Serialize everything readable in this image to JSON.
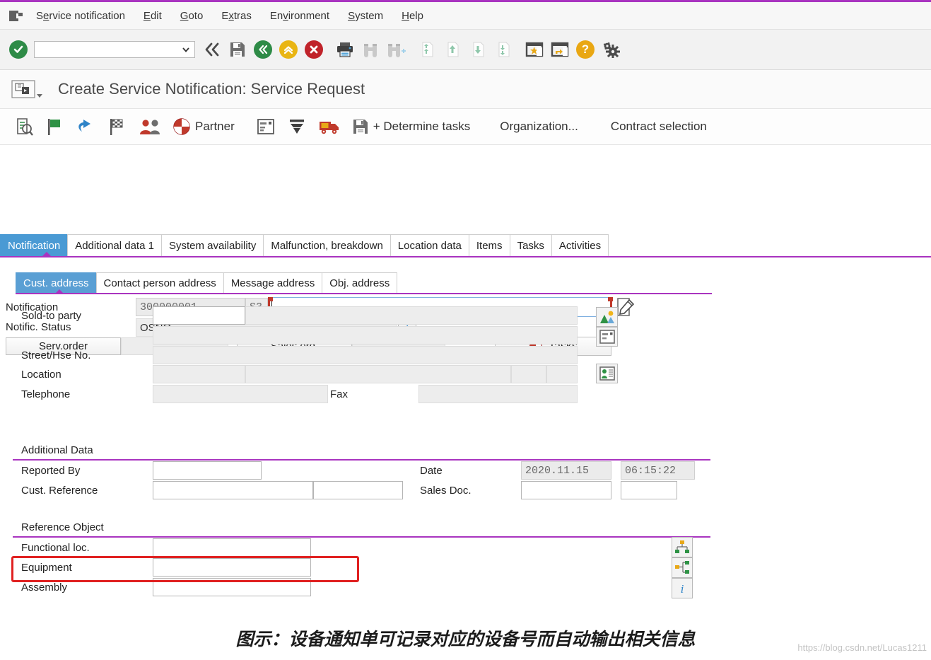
{
  "menubar": {
    "system_icon": "sap-exit-icon",
    "items": [
      {
        "pre": "S",
        "acc": "e",
        "post": "rvice notification"
      },
      {
        "pre": "",
        "acc": "E",
        "post": "dit"
      },
      {
        "pre": "",
        "acc": "G",
        "post": "oto"
      },
      {
        "pre": "E",
        "acc": "x",
        "post": "tras"
      },
      {
        "pre": "En",
        "acc": "v",
        "post": "ironment"
      },
      {
        "pre": "",
        "acc": "S",
        "post": "ystem"
      },
      {
        "pre": "",
        "acc": "H",
        "post": "elp"
      }
    ],
    "labels": [
      "Service notification",
      "Edit",
      "Goto",
      "Extras",
      "Environment",
      "System",
      "Help"
    ]
  },
  "std_toolbar": {
    "command_field_value": "",
    "command_field_placeholder": "",
    "buttons": [
      {
        "name": "enter-button",
        "icon": "green-check-icon",
        "enabled": true
      },
      {
        "name": "back-button",
        "icon": "back-double-arrow-icon",
        "enabled": true
      },
      {
        "name": "save-button",
        "icon": "save-floppy-icon",
        "enabled": true
      },
      {
        "name": "exit-button",
        "icon": "green-back-circle-icon",
        "enabled": true
      },
      {
        "name": "up-button",
        "icon": "yellow-up-circle-icon",
        "enabled": true
      },
      {
        "name": "cancel-button",
        "icon": "red-cancel-circle-icon",
        "enabled": true
      },
      {
        "name": "print-button",
        "icon": "printer-icon",
        "enabled": true
      },
      {
        "name": "find-button",
        "icon": "binoculars-icon",
        "enabled": false
      },
      {
        "name": "find-next-button",
        "icon": "binoculars-plus-icon",
        "enabled": false
      },
      {
        "name": "first-page-button",
        "icon": "first-page-icon",
        "enabled": false
      },
      {
        "name": "previous-page-button",
        "icon": "previous-page-icon",
        "enabled": false
      },
      {
        "name": "next-page-button",
        "icon": "next-page-icon",
        "enabled": false
      },
      {
        "name": "last-page-button",
        "icon": "last-page-icon",
        "enabled": false
      },
      {
        "name": "create-shortcut-button",
        "icon": "star-window-icon",
        "enabled": true
      },
      {
        "name": "customize-layout-button",
        "icon": "layout-window-icon",
        "enabled": true
      },
      {
        "name": "help-button",
        "icon": "question-help-icon",
        "enabled": true
      },
      {
        "name": "customizing-button",
        "icon": "gear-settings-icon",
        "enabled": true
      }
    ]
  },
  "title": {
    "icon": "transaction-icon",
    "text": "Create Service Notification: Service Request"
  },
  "app_toolbar": {
    "buttons": [
      {
        "name": "display-document-button",
        "icon": "document-display-icon",
        "label": ""
      },
      {
        "name": "complete-flag-button",
        "icon": "green-flag-icon",
        "label": ""
      },
      {
        "name": "undo-button",
        "icon": "undo-arrow-icon",
        "label": ""
      },
      {
        "name": "finish-flag-button",
        "icon": "checkered-flag-icon",
        "label": ""
      },
      {
        "name": "partners-button",
        "icon": "two-people-icon",
        "label": ""
      },
      {
        "name": "partner-button",
        "icon": "partner-pie-icon",
        "label": "Partner"
      },
      {
        "name": "list-detail-button",
        "icon": "list-detail-icon",
        "label": ""
      },
      {
        "name": "sort-down-button",
        "icon": "sort-down-icon",
        "label": ""
      },
      {
        "name": "delivery-button",
        "icon": "truck-icon",
        "label": ""
      },
      {
        "name": "determine-tasks-button",
        "icon": "save-plus-icon",
        "label": "+ Determine tasks"
      },
      {
        "name": "organization-button",
        "icon": "",
        "label": "Organization..."
      },
      {
        "name": "contract-selection-button",
        "icon": "",
        "label": "Contract selection"
      }
    ]
  },
  "header": {
    "notification_label": "Notification",
    "notification_number": "300000001",
    "notification_type": "S3",
    "notification_description": "",
    "long_text_icon": "long-text-edit-icon",
    "status_label": "Notific. Status",
    "status_value": "OSNO",
    "status_info_icon": "info-i-icon",
    "buttons": {
      "serv_order": "Serv.order",
      "serv_order_value": "",
      "sales_order": "Sales ord.",
      "sales_order_value": "",
      "tasks": "Tasks",
      "tasks_icon": "partner-pie-icon"
    }
  },
  "tabs": {
    "items": [
      {
        "label": "Notification",
        "active": true
      },
      {
        "label": "Additional data 1",
        "active": false
      },
      {
        "label": "System availability",
        "active": false
      },
      {
        "label": "Malfunction, breakdown",
        "active": false
      },
      {
        "label": "Location data",
        "active": false
      },
      {
        "label": "Items",
        "active": false
      },
      {
        "label": "Tasks",
        "active": false
      },
      {
        "label": "Activities",
        "active": false
      }
    ]
  },
  "subtabs": {
    "items": [
      {
        "label": "Cust. address",
        "active": true
      },
      {
        "label": "Contact person address",
        "active": false
      },
      {
        "label": "Message address",
        "active": false
      },
      {
        "label": "Obj. address",
        "active": false
      }
    ]
  },
  "cust_address": {
    "fields": [
      {
        "label": "Sold-to party",
        "value": ""
      },
      {
        "label": "",
        "value": ""
      },
      {
        "label": "Street/Hse No.",
        "value": ""
      },
      {
        "label": "Location",
        "value": ""
      },
      {
        "label": "Telephone",
        "value": ""
      }
    ],
    "fax_label": "Fax",
    "fax_value": "",
    "side_icons": [
      {
        "name": "picture-icon"
      },
      {
        "name": "address-card-icon"
      },
      {
        "name": "business-card-person-icon"
      }
    ]
  },
  "additional_data": {
    "title": "Additional Data",
    "reported_by_label": "Reported By",
    "reported_by_value": "",
    "cust_reference_label": "Cust. Reference",
    "cust_reference_value": "",
    "cust_reference_value2": "",
    "date_label": "Date",
    "date_value": "2020.11.15",
    "time_value": "06:15:22",
    "sales_doc_label": "Sales Doc.",
    "sales_doc_value": "",
    "sales_doc_value2": ""
  },
  "reference_object": {
    "title": "Reference Object",
    "functional_loc_label": "Functional loc.",
    "functional_loc_value": "",
    "equipment_label": "Equipment",
    "equipment_value": "",
    "assembly_label": "Assembly",
    "assembly_value": "",
    "side_icons": [
      {
        "name": "structure-hierarchy-icon"
      },
      {
        "name": "structure-list-icon"
      },
      {
        "name": "info-i-icon"
      }
    ],
    "highlight_color": "#e02121"
  },
  "caption": {
    "text": "图示：设备通知单可记录对应的设备号而自动输出相关信息",
    "watermark": "https://blog.csdn.net/Lucas1211"
  },
  "colors": {
    "accent_purple": "#a934c0",
    "tab_active_blue": "#4a9ad4",
    "annotation_red": "#e02121"
  }
}
